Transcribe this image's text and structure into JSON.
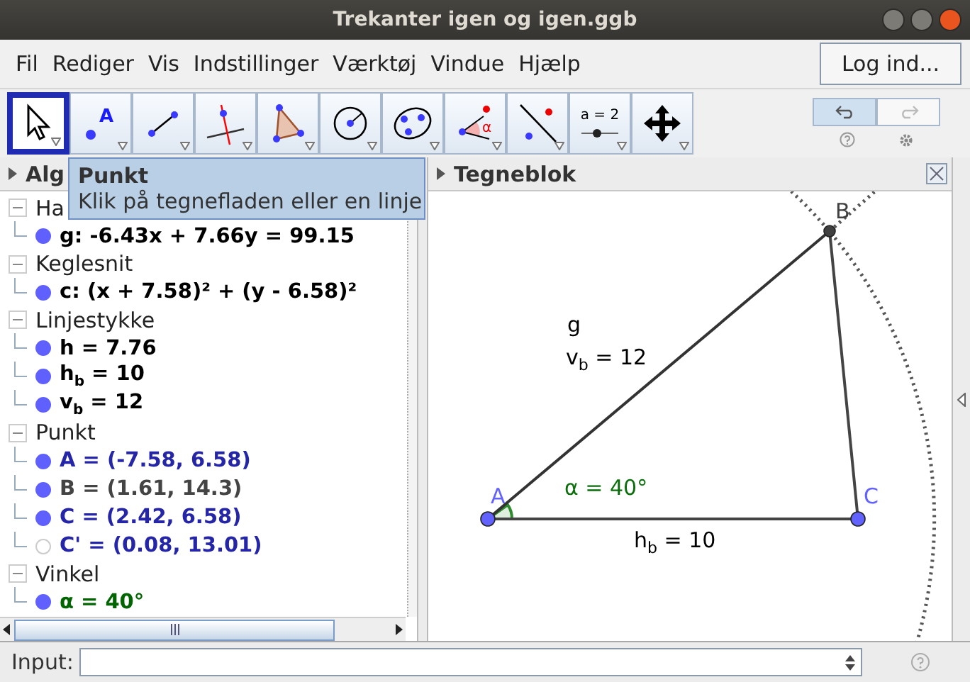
{
  "window": {
    "title": "Trekanter igen og igen.ggb"
  },
  "menu": [
    "Fil",
    "Rediger",
    "Vis",
    "Indstillinger",
    "Værktøj",
    "Vindue",
    "Hjælp"
  ],
  "login_button": "Log ind...",
  "toolbar": {
    "tools": [
      {
        "kind": "move",
        "selected": true
      },
      {
        "kind": "point",
        "glyph": "A",
        "selected": false
      },
      {
        "kind": "segment",
        "selected": false
      },
      {
        "kind": "perpendicular",
        "selected": false
      },
      {
        "kind": "polygon",
        "selected": false
      },
      {
        "kind": "circle",
        "selected": false
      },
      {
        "kind": "conic",
        "selected": false
      },
      {
        "kind": "angle",
        "glyph": "α",
        "selected": false
      },
      {
        "kind": "reflect",
        "selected": false
      },
      {
        "kind": "slider",
        "glyph": "a = 2",
        "selected": false
      },
      {
        "kind": "move-view",
        "selected": false
      }
    ],
    "undo": {
      "disabled": false
    },
    "redo": {
      "disabled": true
    }
  },
  "tooltip": {
    "title": "Punkt",
    "text": "Klik på tegnefladen eller en linje"
  },
  "algebra": {
    "title": "Alg",
    "groups": [
      {
        "label": "Ha",
        "expanded": true,
        "children": [
          {
            "text": "g: -6.43x + 7.66y = 99.15",
            "visible": true,
            "color": "#000000"
          }
        ]
      },
      {
        "label": "Keglesnit",
        "expanded": true,
        "children": [
          {
            "text": "c: (x + 7.58)² + (y - 6.58)²",
            "visible": true,
            "color": "#000000"
          }
        ]
      },
      {
        "label": "Linjestykke",
        "expanded": true,
        "children": [
          {
            "text": "h = 7.76",
            "visible": true,
            "color": "#000000"
          },
          {
            "text": "h$_{b}$ = 10",
            "visible": true,
            "color": "#000000"
          },
          {
            "text": "v$_{b}$ = 12",
            "visible": true,
            "color": "#000000"
          }
        ]
      },
      {
        "label": "Punkt",
        "expanded": true,
        "children": [
          {
            "text": "A = (-7.58, 6.58)",
            "visible": true,
            "color": "#2525a8"
          },
          {
            "text": "B = (1.61, 14.3)",
            "visible": true,
            "color": "#444444"
          },
          {
            "text": "C = (2.42, 6.58)",
            "visible": true,
            "color": "#2525a8"
          },
          {
            "text": "C' = (0.08, 13.01)",
            "visible": false,
            "color": "#2525a8"
          }
        ]
      },
      {
        "label": "Vinkel",
        "expanded": true,
        "children": [
          {
            "text": "α = 40°",
            "visible": true,
            "color": "#006400"
          }
        ]
      }
    ]
  },
  "graphics": {
    "title": "Tegneblok",
    "points": [
      {
        "label": "A",
        "color": "#6262ff"
      },
      {
        "label": "B",
        "color": "#404040"
      },
      {
        "label": "C",
        "color": "#6262ff"
      }
    ],
    "labels": [
      {
        "text": "g",
        "color": "#000000"
      },
      {
        "text": "v$_{b}$ = 12",
        "color": "#000000"
      },
      {
        "text": "α = 40°",
        "color": "#0a6e0a"
      },
      {
        "text": "h$_{b}$ = 10",
        "color": "#000000"
      }
    ]
  },
  "input": {
    "label": "Input:"
  }
}
